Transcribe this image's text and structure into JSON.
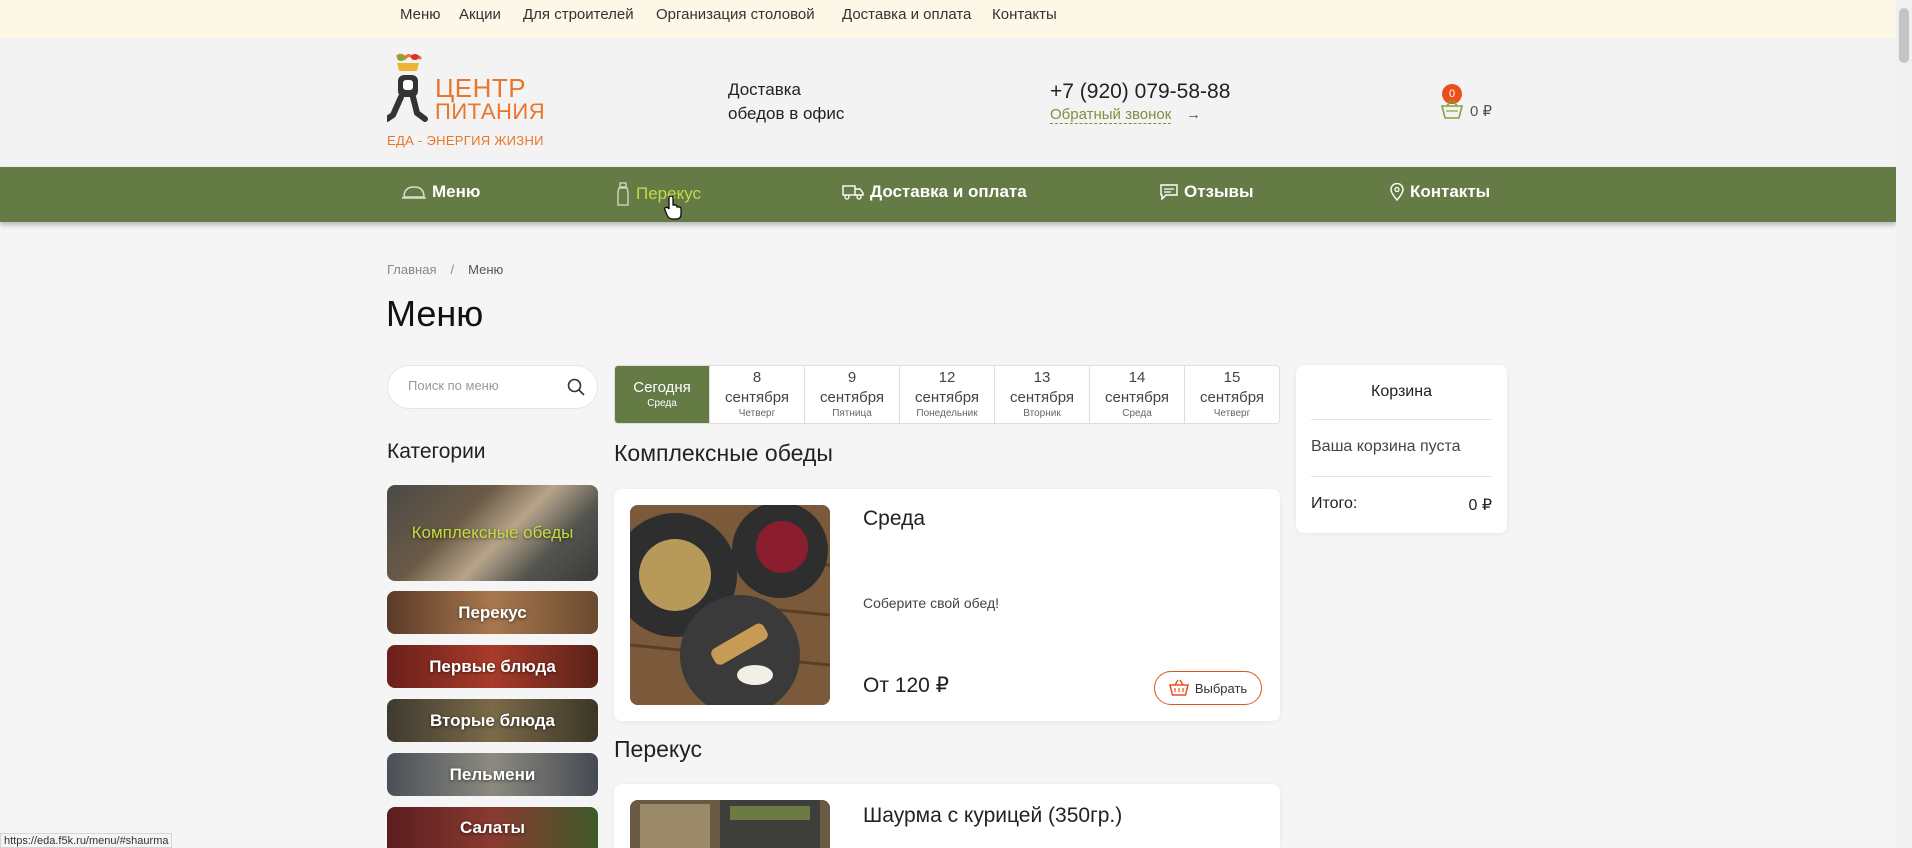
{
  "topbar": {
    "links": [
      "Меню",
      "Акции",
      "Для строителей",
      "Организация столовой",
      "Доставка и оплата",
      "Контакты"
    ]
  },
  "header": {
    "logo_line1": "ЦЕНТР",
    "logo_line2": "ПИТАНИЯ",
    "slogan": "ЕДА - ЭНЕРГИЯ ЖИЗНИ",
    "delivery_line1": "Доставка",
    "delivery_line2": "обедов в офис",
    "phone": "+7 (920) 079-58-88",
    "callback": "Обратный звонок",
    "callback_arrow": "→",
    "cart_count": "0",
    "cart_sum": "0 ₽"
  },
  "nav": {
    "items": [
      {
        "label": "Меню",
        "icon": "cloche-icon"
      },
      {
        "label": "Перекус",
        "icon": "bottle-icon"
      },
      {
        "label": "Доставка и оплата",
        "icon": "truck-icon"
      },
      {
        "label": "Отзывы",
        "icon": "comment-icon"
      },
      {
        "label": "Контакты",
        "icon": "location-pin-icon"
      }
    ]
  },
  "breadcrumb": {
    "home": "Главная",
    "sep": "/",
    "current": "Меню"
  },
  "page_title": "Меню",
  "search": {
    "placeholder": "Поиск по меню",
    "icon": "search-icon"
  },
  "categories": {
    "title": "Категории",
    "items": [
      "Комплексные обеды",
      "Перекус",
      "Первые блюда",
      "Вторые блюда",
      "Пельмени",
      "Салаты"
    ]
  },
  "dates": [
    {
      "line1": "Сегодня",
      "line2": "",
      "day": "Среда"
    },
    {
      "line1": "8",
      "line2": "сентября",
      "day": "Четверг"
    },
    {
      "line1": "9",
      "line2": "сентября",
      "day": "Пятница"
    },
    {
      "line1": "12",
      "line2": "сентября",
      "day": "Понедельник"
    },
    {
      "line1": "13",
      "line2": "сентября",
      "day": "Вторник"
    },
    {
      "line1": "14",
      "line2": "сентября",
      "day": "Среда"
    },
    {
      "line1": "15",
      "line2": "сентября",
      "day": "Четверг"
    }
  ],
  "sections": [
    {
      "title": "Комплексные обеды",
      "card": {
        "title": "Среда",
        "desc": "Соберите свой обед!",
        "price": "От 120 ₽",
        "button": "Выбрать"
      }
    },
    {
      "title": "Перекус",
      "card": {
        "title": "Шаурма с курицей (350гр.)"
      }
    }
  ],
  "cart_panel": {
    "title": "Корзина",
    "empty": "Ваша корзина пуста",
    "total_label": "Итого:",
    "total_value": "0 ₽"
  },
  "status_url": "https://eda.f5k.ru/menu/#shaurma",
  "colors": {
    "green": "#647b45",
    "orange": "#e9762b",
    "accent_red": "#e8501c",
    "lime": "#c6dc3f"
  }
}
